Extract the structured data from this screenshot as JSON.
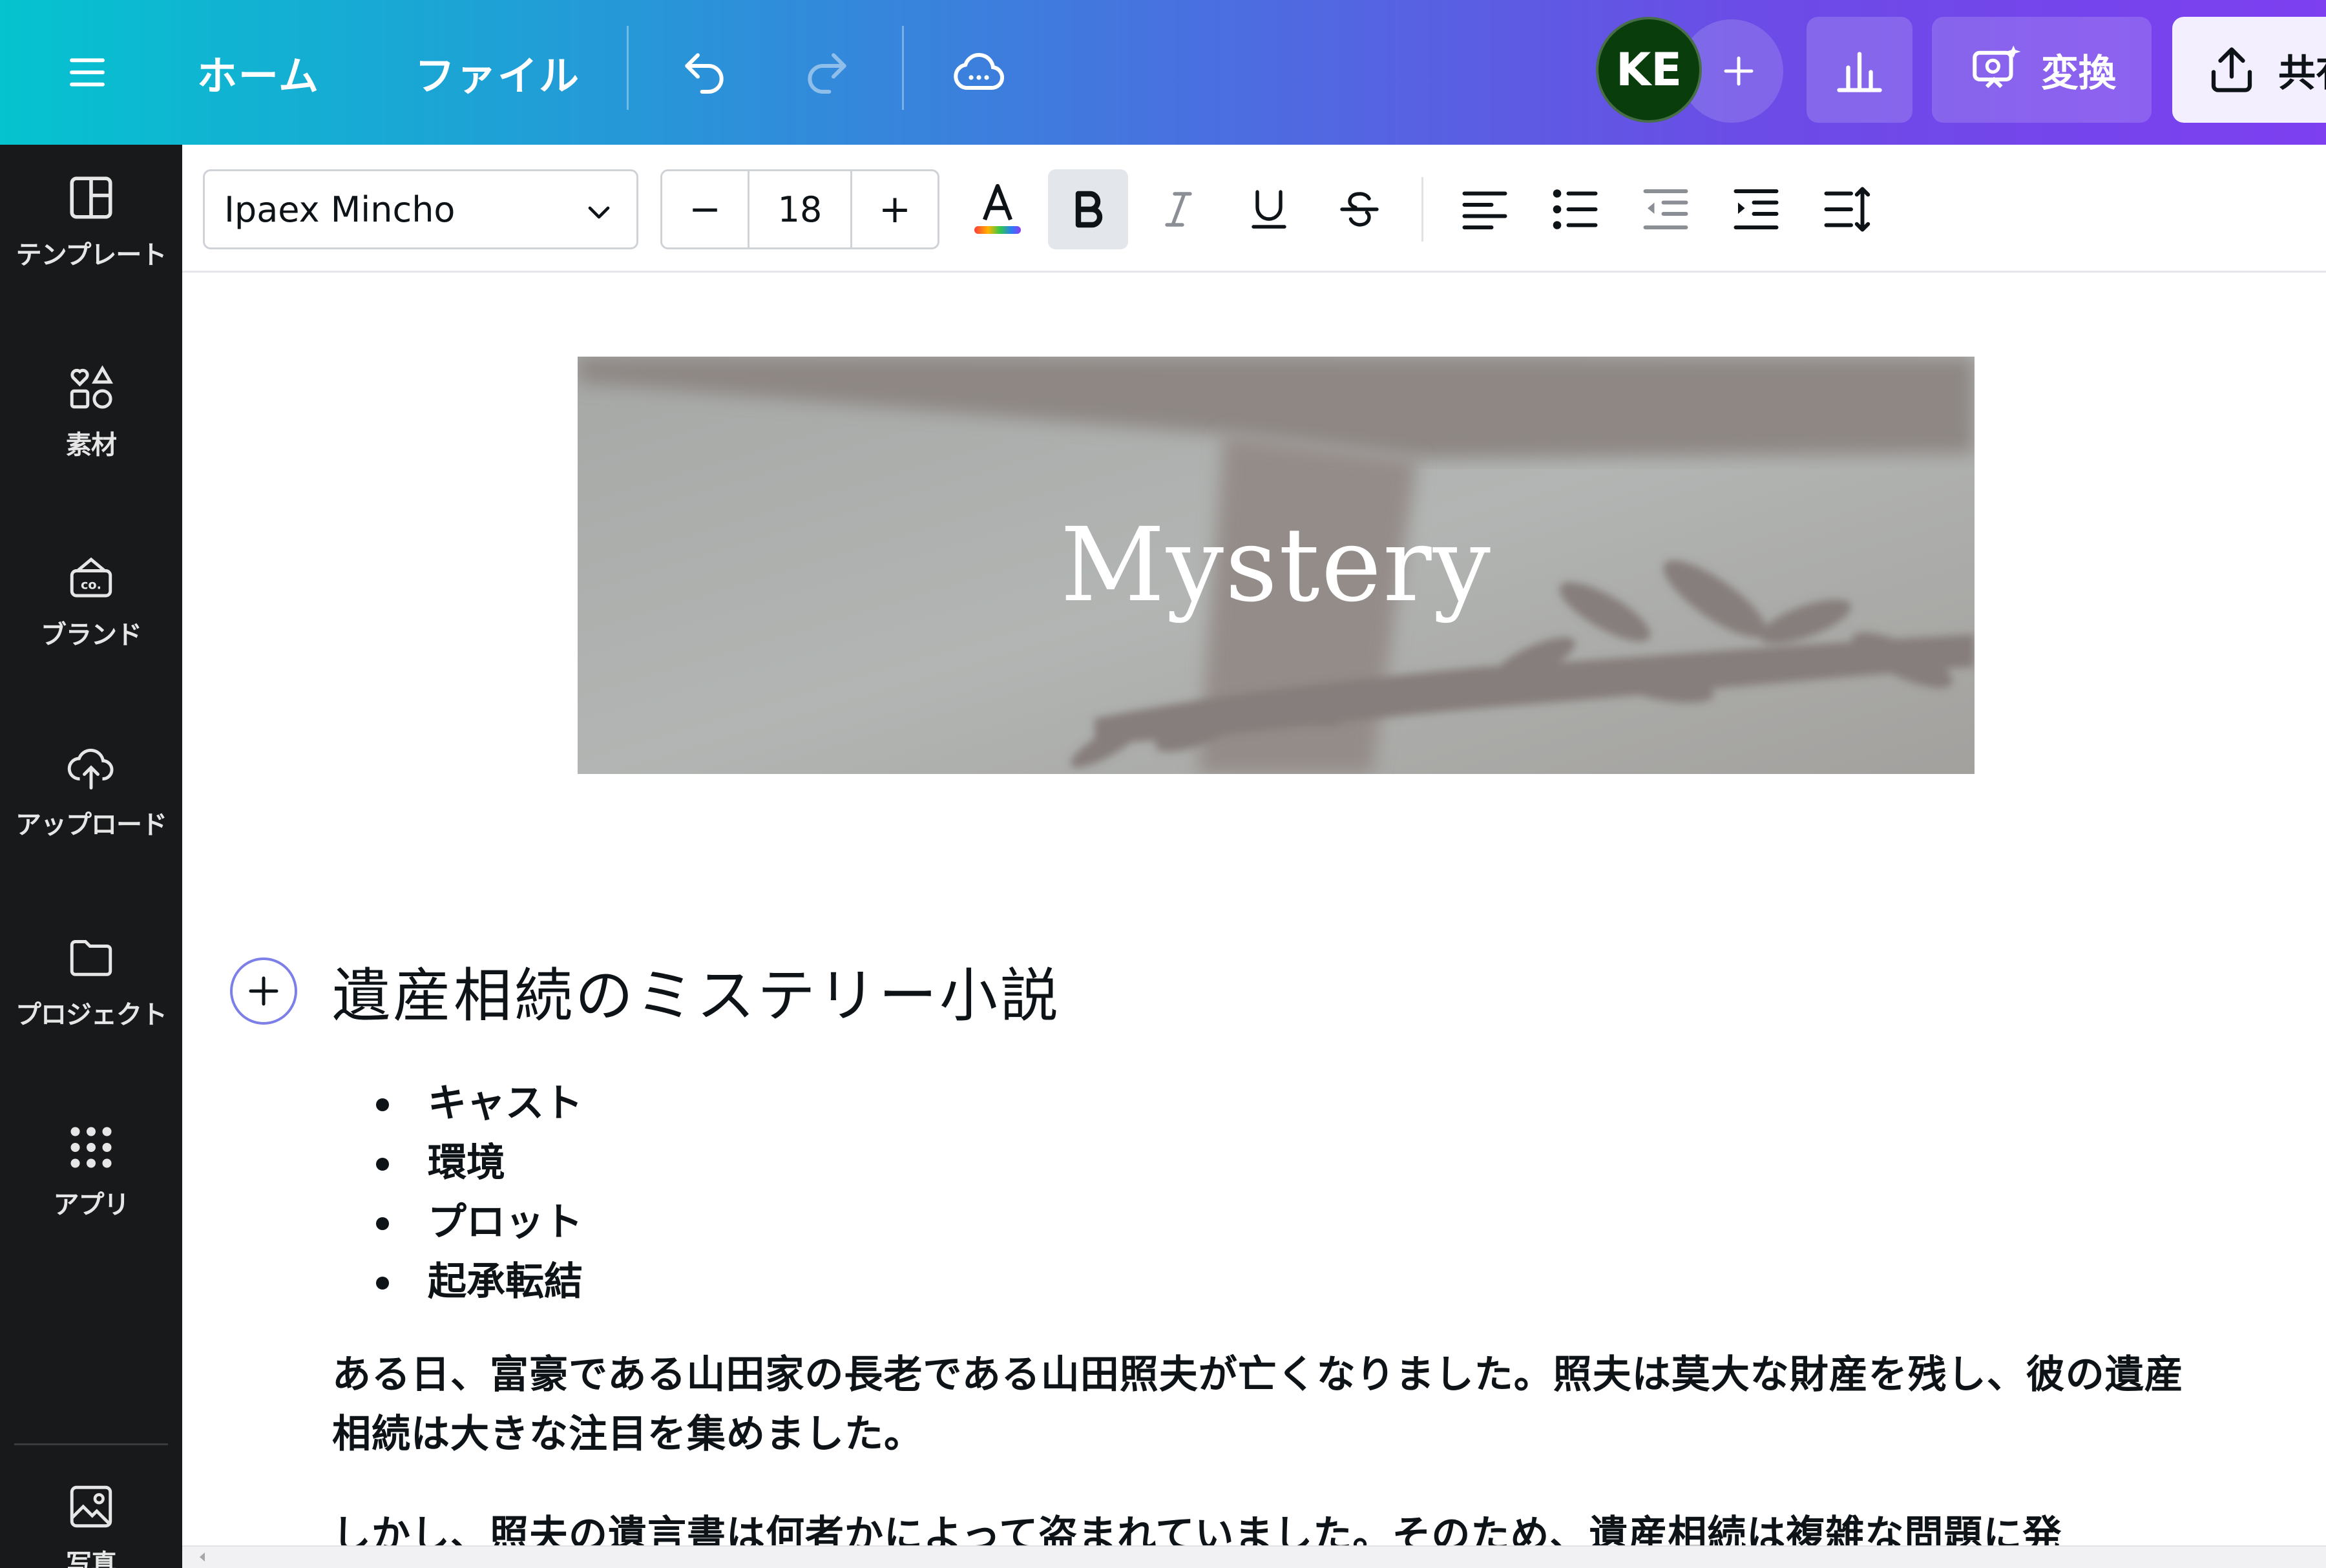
{
  "topbar": {
    "home_label": "ホーム",
    "file_label": "ファイル",
    "avatar_initials": "KE",
    "convert_label": "変換",
    "share_label": "共有",
    "icons": [
      "menu-icon",
      "undo-icon",
      "redo-icon",
      "cloud-sync-icon",
      "plus-icon",
      "analytics-icon",
      "magic-convert-icon",
      "share-icon"
    ]
  },
  "sidebar": {
    "items": [
      {
        "label": "テンプレート",
        "icon": "template-icon"
      },
      {
        "label": "素材",
        "icon": "elements-icon"
      },
      {
        "label": "ブランド",
        "icon": "brand-icon"
      },
      {
        "label": "アップロード",
        "icon": "upload-icon"
      },
      {
        "label": "プロジェクト",
        "icon": "folder-icon"
      },
      {
        "label": "アプリ",
        "icon": "apps-icon"
      },
      {
        "label": "写真",
        "icon": "photo-icon"
      }
    ]
  },
  "text_toolbar": {
    "font_family": "Ipaex Mincho",
    "font_size": "18",
    "minus_label": "−",
    "plus_label": "+",
    "text_color_gradient": [
      "#ff3b3b",
      "#ffb300",
      "#31c94b",
      "#2a7cf6",
      "#8d3cf0"
    ],
    "bold_active": true
  },
  "document": {
    "banner_title": "Mystery",
    "heading": "遺産相続のミステリー小説",
    "list_items": [
      "キャスト",
      "環境",
      "プロット",
      "起承転結"
    ],
    "paragraph_1": "ある日、富豪である山田家の長老である山田照夫が亡くなりました。照夫は莫大な財産を残し、彼の遺産相続は大きな注目を集めました。",
    "paragraph_2": "しかし、照夫の遺言書は何者かによって盗まれていました。そのため、遺産相続は複雑な問題に発"
  },
  "colors": {
    "topbar_gradient_start": "#05c3cf",
    "topbar_gradient_end": "#7d3ff0",
    "sidebar_bg": "#18191b",
    "avatar_bg": "#0a3d0c",
    "share_bg": "#f3efff"
  }
}
